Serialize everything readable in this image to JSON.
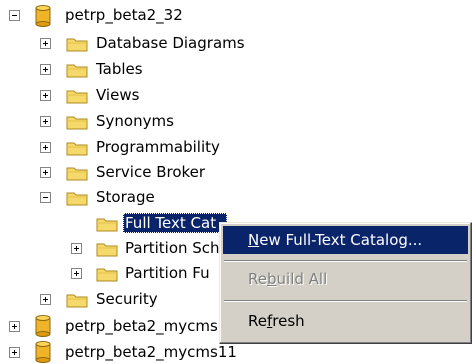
{
  "tree": {
    "db1": {
      "label": "petrp_beta2_32"
    },
    "children": [
      "Database Diagrams",
      "Tables",
      "Views",
      "Synonyms",
      "Programmability",
      "Service Broker",
      "Storage"
    ],
    "storage_children": [
      "Full Text Cat",
      "Partition Sch",
      "Partition Fu"
    ],
    "security": "Security",
    "db2": {
      "label": "petrp_beta2_mycms"
    },
    "db3": {
      "label": "petrp_beta2_mycms11"
    }
  },
  "context_menu": {
    "new_catalog": {
      "pre": "",
      "key": "N",
      "post": "ew Full-Text Catalog..."
    },
    "rebuild_all": {
      "pre": "Re",
      "key": "b",
      "post": "uild All"
    },
    "refresh": {
      "pre": "Re",
      "key": "f",
      "post": "resh"
    }
  },
  "colors": {
    "selection": "#0a246a",
    "menu_bg": "#d4d0c8",
    "folder": "#f5d96a",
    "db_cylinder": "#f0b429"
  },
  "icons": [
    "database-icon",
    "folder-icon",
    "expand-plus-icon",
    "collapse-minus-icon"
  ]
}
